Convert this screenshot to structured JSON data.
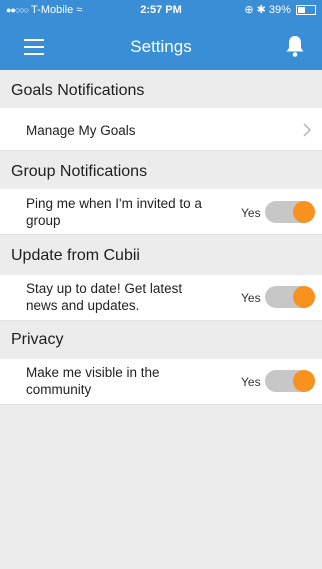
{
  "status_bar": {
    "carrier": "T-Mobile",
    "time": "2:57 PM",
    "battery": "39%"
  },
  "header": {
    "title": "Settings",
    "menu_icon": "hamburger-menu-icon",
    "bell_icon": "bell-icon"
  },
  "sections": {
    "goals": {
      "title": "Goals Notifications",
      "manage_label": "Manage My Goals"
    },
    "group": {
      "title": "Group Notifications",
      "ping_label_line1": "Ping me when I'm invited to a",
      "ping_label_line2": "group",
      "ping_toggle_text": "Yes"
    },
    "update": {
      "title": "Update from Cubii",
      "label_line1": "Stay up to date! Get latest",
      "label_line2": "news and updates.",
      "toggle_text": "Yes"
    },
    "privacy": {
      "title": "Privacy",
      "label_line1": "Make me visible in the",
      "label_line2": "community",
      "toggle_text": "Yes"
    }
  },
  "colors": {
    "header_bg": "#3a8ed6",
    "toggle_on": "#f7921e",
    "toggle_track": "#c7c7c7",
    "page_bg": "#ececec"
  },
  "toggles": {
    "ping": true,
    "update": true,
    "privacy": true
  }
}
